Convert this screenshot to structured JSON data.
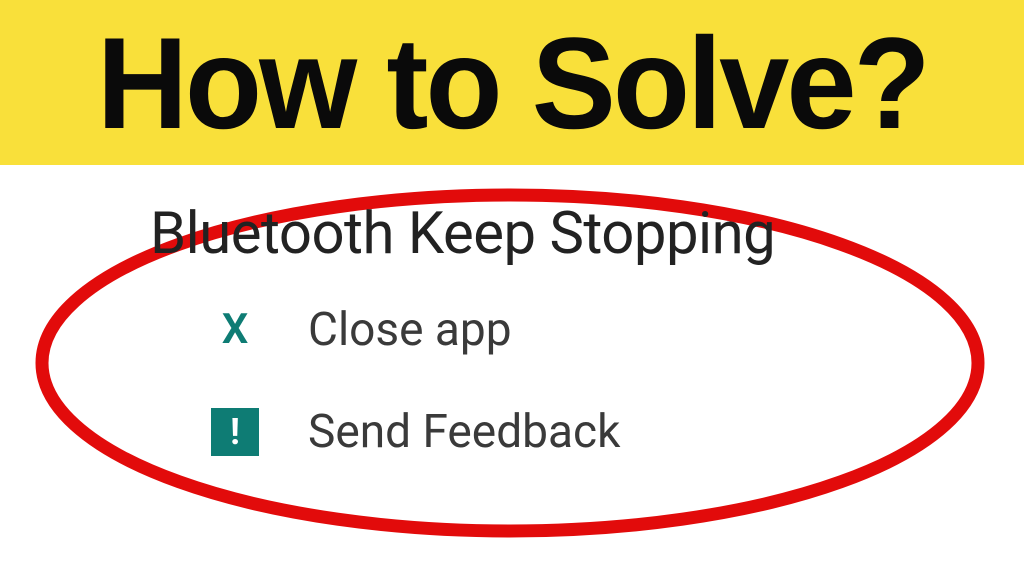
{
  "banner": {
    "title": "How to Solve?"
  },
  "dialog": {
    "title": "Bluetooth Keep Stopping",
    "options": [
      {
        "icon": "close",
        "label": "Close app"
      },
      {
        "icon": "feedback",
        "label": "Send Feedback"
      }
    ]
  },
  "colors": {
    "banner_bg": "#f9e03a",
    "accent": "#0e7c74",
    "highlight_ring": "#e20b0b"
  }
}
